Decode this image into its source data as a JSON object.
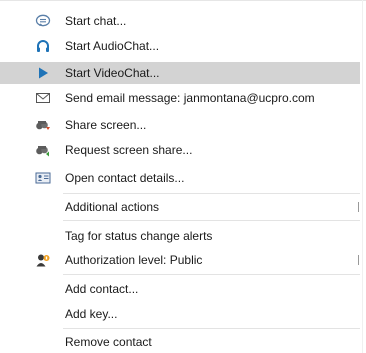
{
  "menu": {
    "items": [
      {
        "label": "Start chat...",
        "icon": "chat-icon"
      },
      {
        "label": "Start AudioChat...",
        "icon": "headset-icon"
      },
      {
        "label": "Start VideoChat...",
        "icon": "play-icon",
        "highlighted": true
      },
      {
        "label": "Send email message: janmontana@ucpro.com",
        "icon": "envelope-icon"
      },
      {
        "label": "Share screen...",
        "icon": "share-screen-icon"
      },
      {
        "label": "Request screen share...",
        "icon": "request-screen-share-icon"
      },
      {
        "label": "Open contact details...",
        "icon": "contact-card-icon"
      },
      {
        "label": "Additional actions",
        "icon": "",
        "submenu": true
      },
      {
        "label": "Tag for status change alerts",
        "icon": ""
      },
      {
        "label": "Authorization level: Public",
        "icon": "user-authorization-icon",
        "submenu": true
      },
      {
        "label": "Add contact...",
        "icon": ""
      },
      {
        "label": "Add key...",
        "icon": ""
      },
      {
        "label": "Remove contact",
        "icon": ""
      }
    ]
  },
  "colors": {
    "highlight": "#d3d3d3",
    "accent_blue": "#1f73b7",
    "separator": "#e3e3e3"
  }
}
